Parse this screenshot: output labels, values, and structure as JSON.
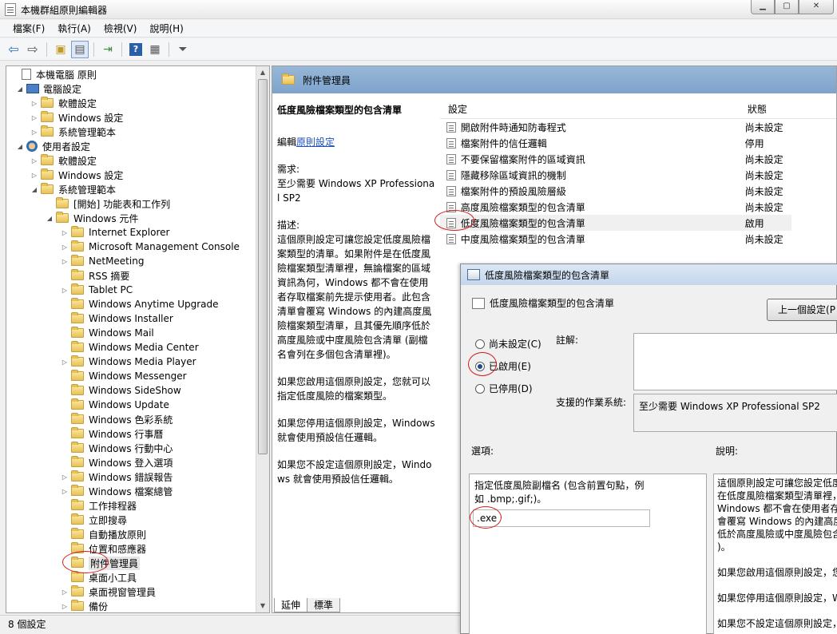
{
  "window": {
    "title": "本機群組原則編輯器",
    "buttons": [
      "▁",
      "▢",
      "✕"
    ]
  },
  "menu": [
    "檔案(F)",
    "執行(A)",
    "檢視(V)",
    "說明(H)"
  ],
  "toolbar": {
    "icons": [
      "back-arrow-icon",
      "forward-arrow-icon",
      "up-folder-icon",
      "show-tree-icon",
      "export-list-icon",
      "help-icon",
      "properties-icon",
      "filter-icon"
    ]
  },
  "tree": {
    "items": [
      {
        "label": "本機電腦 原則",
        "indent": 0,
        "toggle": "",
        "icon": "doc"
      },
      {
        "label": "電腦設定",
        "indent": 1,
        "toggle": "◢",
        "icon": "pc"
      },
      {
        "label": "軟體設定",
        "indent": 2,
        "toggle": "▷",
        "icon": "folder"
      },
      {
        "label": "Windows 設定",
        "indent": 2,
        "toggle": "▷",
        "icon": "folder"
      },
      {
        "label": "系統管理範本",
        "indent": 2,
        "toggle": "▷",
        "icon": "folder"
      },
      {
        "label": "使用者設定",
        "indent": 1,
        "toggle": "◢",
        "icon": "user"
      },
      {
        "label": "軟體設定",
        "indent": 2,
        "toggle": "▷",
        "icon": "folder"
      },
      {
        "label": "Windows 設定",
        "indent": 2,
        "toggle": "▷",
        "icon": "folder"
      },
      {
        "label": "系統管理範本",
        "indent": 2,
        "toggle": "◢",
        "icon": "folder"
      },
      {
        "label": "[開始] 功能表和工作列",
        "indent": 3,
        "toggle": "",
        "icon": "folder"
      },
      {
        "label": "Windows 元件",
        "indent": 3,
        "toggle": "◢",
        "icon": "folder"
      },
      {
        "label": "Internet Explorer",
        "indent": 4,
        "toggle": "▷",
        "icon": "folder"
      },
      {
        "label": "Microsoft Management Console",
        "indent": 4,
        "toggle": "▷",
        "icon": "folder"
      },
      {
        "label": "NetMeeting",
        "indent": 4,
        "toggle": "▷",
        "icon": "folder"
      },
      {
        "label": "RSS 摘要",
        "indent": 4,
        "toggle": "",
        "icon": "folder"
      },
      {
        "label": "Tablet PC",
        "indent": 4,
        "toggle": "▷",
        "icon": "folder"
      },
      {
        "label": "Windows Anytime Upgrade",
        "indent": 4,
        "toggle": "",
        "icon": "folder"
      },
      {
        "label": "Windows Installer",
        "indent": 4,
        "toggle": "",
        "icon": "folder"
      },
      {
        "label": "Windows Mail",
        "indent": 4,
        "toggle": "",
        "icon": "folder"
      },
      {
        "label": "Windows Media Center",
        "indent": 4,
        "toggle": "",
        "icon": "folder"
      },
      {
        "label": "Windows Media Player",
        "indent": 4,
        "toggle": "▷",
        "icon": "folder"
      },
      {
        "label": "Windows Messenger",
        "indent": 4,
        "toggle": "",
        "icon": "folder"
      },
      {
        "label": "Windows SideShow",
        "indent": 4,
        "toggle": "",
        "icon": "folder"
      },
      {
        "label": "Windows Update",
        "indent": 4,
        "toggle": "",
        "icon": "folder"
      },
      {
        "label": "Windows 色彩系統",
        "indent": 4,
        "toggle": "",
        "icon": "folder"
      },
      {
        "label": "Windows 行事曆",
        "indent": 4,
        "toggle": "",
        "icon": "folder"
      },
      {
        "label": "Windows 行動中心",
        "indent": 4,
        "toggle": "",
        "icon": "folder"
      },
      {
        "label": "Windows 登入選項",
        "indent": 4,
        "toggle": "",
        "icon": "folder"
      },
      {
        "label": "Windows 錯誤報告",
        "indent": 4,
        "toggle": "▷",
        "icon": "folder"
      },
      {
        "label": "Windows 檔案總管",
        "indent": 4,
        "toggle": "▷",
        "icon": "folder"
      },
      {
        "label": "工作排程器",
        "indent": 4,
        "toggle": "",
        "icon": "folder"
      },
      {
        "label": "立即搜尋",
        "indent": 4,
        "toggle": "",
        "icon": "folder"
      },
      {
        "label": "自動播放原則",
        "indent": 4,
        "toggle": "",
        "icon": "folder"
      },
      {
        "label": "位置和感應器",
        "indent": 4,
        "toggle": "",
        "icon": "folder"
      },
      {
        "label": "附件管理員",
        "indent": 4,
        "toggle": "",
        "icon": "folder",
        "selected": true
      },
      {
        "label": "桌面小工具",
        "indent": 4,
        "toggle": "",
        "icon": "folder"
      },
      {
        "label": "桌面視窗管理員",
        "indent": 4,
        "toggle": "▷",
        "icon": "folder"
      },
      {
        "label": "備份",
        "indent": 4,
        "toggle": "▷",
        "icon": "folder"
      }
    ]
  },
  "right": {
    "folder_title": "附件管理員",
    "desc_title": "低度風險檔案類型的包含清單",
    "edit_prefix": "編輯",
    "edit_link": "原則設定",
    "requirement": "需求:\n至少需要 Windows XP Professional SP2",
    "description": "描述:\n這個原則設定可讓您設定低度風險檔案類型的清單。如果附件是在低度風險檔案類型清單裡，無論檔案的區域資訊為何，Windows 都不會在使用者存取檔案前先提示使用者。此包含清單會覆寫 Windows 的內建高度風險檔案類型清單，且其優先順序低於高度風險或中度風險包含清單 (副檔名會列在多個包含清單裡)。",
    "enabled_text": "如果您啟用這個原則設定，您就可以指定低度風險的檔案類型。",
    "disabled_text": "如果您停用這個原則設定，Windows 就會使用預設信任邏輯。",
    "notset_text": "如果您不設定這個原則設定，Windows 就會使用預設信任邏輯。",
    "tabs": [
      "延伸",
      "標準"
    ],
    "columns": {
      "setting": "設定",
      "state": "狀態"
    },
    "rows": [
      {
        "name": "開啟附件時通知防毒程式",
        "state": "尚未設定"
      },
      {
        "name": "檔案附件的信任邏輯",
        "state": "停用"
      },
      {
        "name": "不要保留檔案附件的區域資訊",
        "state": "尚未設定"
      },
      {
        "name": "隱藏移除區域資訊的機制",
        "state": "尚未設定"
      },
      {
        "name": "檔案附件的預設風險層級",
        "state": "尚未設定"
      },
      {
        "name": "高度風險檔案類型的包含清單",
        "state": "尚未設定"
      },
      {
        "name": "低度風險檔案類型的包含清單",
        "state": "啟用"
      },
      {
        "name": "中度風險檔案類型的包含清單",
        "state": "尚未設定"
      }
    ]
  },
  "dialog": {
    "title": "低度風險檔案類型的包含清單",
    "header": "低度風險檔案類型的包含清單",
    "prev_button": "上一個設定(P",
    "radio_notset": "尚未設定(C)",
    "radio_enabled": "已啟用(E)",
    "radio_disabled": "已停用(D)",
    "comment_label": "註解:",
    "supported_label": "支援的作業系統:",
    "supported_value": "至少需要 Windows XP Professional SP2",
    "options_label": "選項:",
    "help_label": "說明:",
    "option_hint": "指定低度風險副檔名 (包含前置句點，例如 .bmp;.gif;)。",
    "extension_value": ".exe",
    "help_lines": [
      "這個原則設定可讓您設定低度",
      "在低度風險檔案類型清單裡，",
      "Windows 都不會在使用者存",
      "會覆寫 Windows 的內建高度",
      "低於高度風險或中度風險包含",
      ")。",
      "",
      "如果您啟用這個原則設定，您",
      "",
      "如果您停用這個原則設定，W",
      "",
      "如果您不設定這個原則設定，"
    ]
  },
  "status": {
    "text": "8 個設定"
  },
  "colors": {
    "annotation": "#d21c1c",
    "header_blue": "#8aaed4"
  }
}
